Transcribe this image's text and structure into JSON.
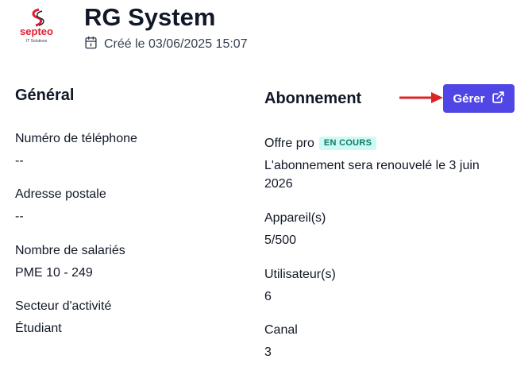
{
  "header": {
    "logo_text": "septeo",
    "logo_subtext": "IT Solutions",
    "title": "RG System",
    "created": "Créé le 03/06/2025 15:07"
  },
  "general": {
    "heading": "Général",
    "fields": [
      {
        "label": "Numéro de téléphone",
        "value": "--"
      },
      {
        "label": "Adresse postale",
        "value": "--"
      },
      {
        "label": "Nombre de salariés",
        "value": "PME 10 - 249"
      },
      {
        "label": "Secteur d'activité",
        "value": "Étudiant"
      }
    ]
  },
  "subscription": {
    "heading": "Abonnement",
    "manage_label": "Gérer",
    "offer_label": "Offre pro",
    "offer_status": "EN COURS",
    "renewal_line1": "L'abonnement sera renouvelé le 3 juin",
    "renewal_line2": "2026",
    "fields": [
      {
        "label": "Appareil(s)",
        "value": "5/500"
      },
      {
        "label": "Utilisateur(s)",
        "value": "6"
      },
      {
        "label": "Canal",
        "value": "3"
      }
    ]
  },
  "colors": {
    "accent": "#4f46e5",
    "arrow": "#dc2626",
    "badge_bg": "#ccfbf1",
    "badge_text": "#0f766e"
  }
}
